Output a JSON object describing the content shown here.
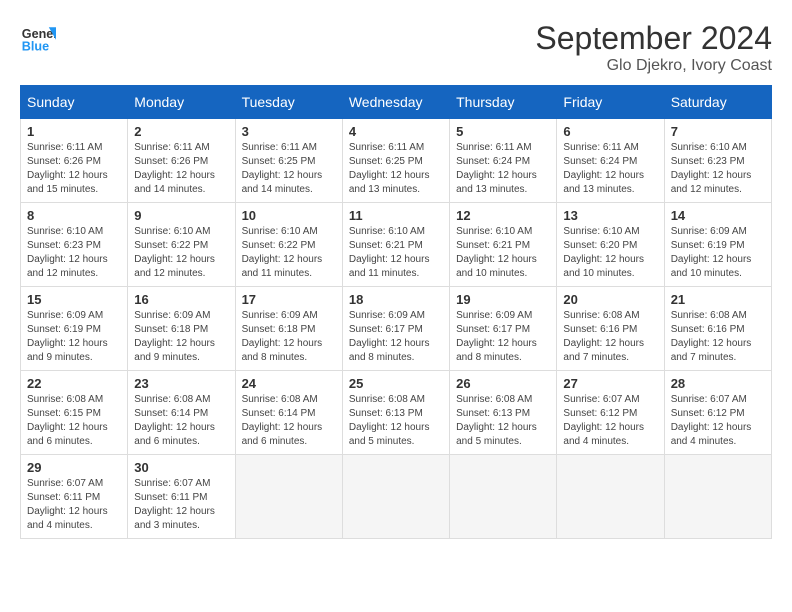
{
  "header": {
    "logo_line1": "General",
    "logo_line2": "Blue",
    "month_year": "September 2024",
    "location": "Glo Djekro, Ivory Coast"
  },
  "weekdays": [
    "Sunday",
    "Monday",
    "Tuesday",
    "Wednesday",
    "Thursday",
    "Friday",
    "Saturday"
  ],
  "weeks": [
    [
      {
        "day": "1",
        "sunrise": "6:11 AM",
        "sunset": "6:26 PM",
        "daylight": "12 hours and 15 minutes."
      },
      {
        "day": "2",
        "sunrise": "6:11 AM",
        "sunset": "6:26 PM",
        "daylight": "12 hours and 14 minutes."
      },
      {
        "day": "3",
        "sunrise": "6:11 AM",
        "sunset": "6:25 PM",
        "daylight": "12 hours and 14 minutes."
      },
      {
        "day": "4",
        "sunrise": "6:11 AM",
        "sunset": "6:25 PM",
        "daylight": "12 hours and 13 minutes."
      },
      {
        "day": "5",
        "sunrise": "6:11 AM",
        "sunset": "6:24 PM",
        "daylight": "12 hours and 13 minutes."
      },
      {
        "day": "6",
        "sunrise": "6:11 AM",
        "sunset": "6:24 PM",
        "daylight": "12 hours and 13 minutes."
      },
      {
        "day": "7",
        "sunrise": "6:10 AM",
        "sunset": "6:23 PM",
        "daylight": "12 hours and 12 minutes."
      }
    ],
    [
      {
        "day": "8",
        "sunrise": "6:10 AM",
        "sunset": "6:23 PM",
        "daylight": "12 hours and 12 minutes."
      },
      {
        "day": "9",
        "sunrise": "6:10 AM",
        "sunset": "6:22 PM",
        "daylight": "12 hours and 12 minutes."
      },
      {
        "day": "10",
        "sunrise": "6:10 AM",
        "sunset": "6:22 PM",
        "daylight": "12 hours and 11 minutes."
      },
      {
        "day": "11",
        "sunrise": "6:10 AM",
        "sunset": "6:21 PM",
        "daylight": "12 hours and 11 minutes."
      },
      {
        "day": "12",
        "sunrise": "6:10 AM",
        "sunset": "6:21 PM",
        "daylight": "12 hours and 10 minutes."
      },
      {
        "day": "13",
        "sunrise": "6:10 AM",
        "sunset": "6:20 PM",
        "daylight": "12 hours and 10 minutes."
      },
      {
        "day": "14",
        "sunrise": "6:09 AM",
        "sunset": "6:19 PM",
        "daylight": "12 hours and 10 minutes."
      }
    ],
    [
      {
        "day": "15",
        "sunrise": "6:09 AM",
        "sunset": "6:19 PM",
        "daylight": "12 hours and 9 minutes."
      },
      {
        "day": "16",
        "sunrise": "6:09 AM",
        "sunset": "6:18 PM",
        "daylight": "12 hours and 9 minutes."
      },
      {
        "day": "17",
        "sunrise": "6:09 AM",
        "sunset": "6:18 PM",
        "daylight": "12 hours and 8 minutes."
      },
      {
        "day": "18",
        "sunrise": "6:09 AM",
        "sunset": "6:17 PM",
        "daylight": "12 hours and 8 minutes."
      },
      {
        "day": "19",
        "sunrise": "6:09 AM",
        "sunset": "6:17 PM",
        "daylight": "12 hours and 8 minutes."
      },
      {
        "day": "20",
        "sunrise": "6:08 AM",
        "sunset": "6:16 PM",
        "daylight": "12 hours and 7 minutes."
      },
      {
        "day": "21",
        "sunrise": "6:08 AM",
        "sunset": "6:16 PM",
        "daylight": "12 hours and 7 minutes."
      }
    ],
    [
      {
        "day": "22",
        "sunrise": "6:08 AM",
        "sunset": "6:15 PM",
        "daylight": "12 hours and 6 minutes."
      },
      {
        "day": "23",
        "sunrise": "6:08 AM",
        "sunset": "6:14 PM",
        "daylight": "12 hours and 6 minutes."
      },
      {
        "day": "24",
        "sunrise": "6:08 AM",
        "sunset": "6:14 PM",
        "daylight": "12 hours and 6 minutes."
      },
      {
        "day": "25",
        "sunrise": "6:08 AM",
        "sunset": "6:13 PM",
        "daylight": "12 hours and 5 minutes."
      },
      {
        "day": "26",
        "sunrise": "6:08 AM",
        "sunset": "6:13 PM",
        "daylight": "12 hours and 5 minutes."
      },
      {
        "day": "27",
        "sunrise": "6:07 AM",
        "sunset": "6:12 PM",
        "daylight": "12 hours and 4 minutes."
      },
      {
        "day": "28",
        "sunrise": "6:07 AM",
        "sunset": "6:12 PM",
        "daylight": "12 hours and 4 minutes."
      }
    ],
    [
      {
        "day": "29",
        "sunrise": "6:07 AM",
        "sunset": "6:11 PM",
        "daylight": "12 hours and 4 minutes."
      },
      {
        "day": "30",
        "sunrise": "6:07 AM",
        "sunset": "6:11 PM",
        "daylight": "12 hours and 3 minutes."
      },
      null,
      null,
      null,
      null,
      null
    ]
  ]
}
